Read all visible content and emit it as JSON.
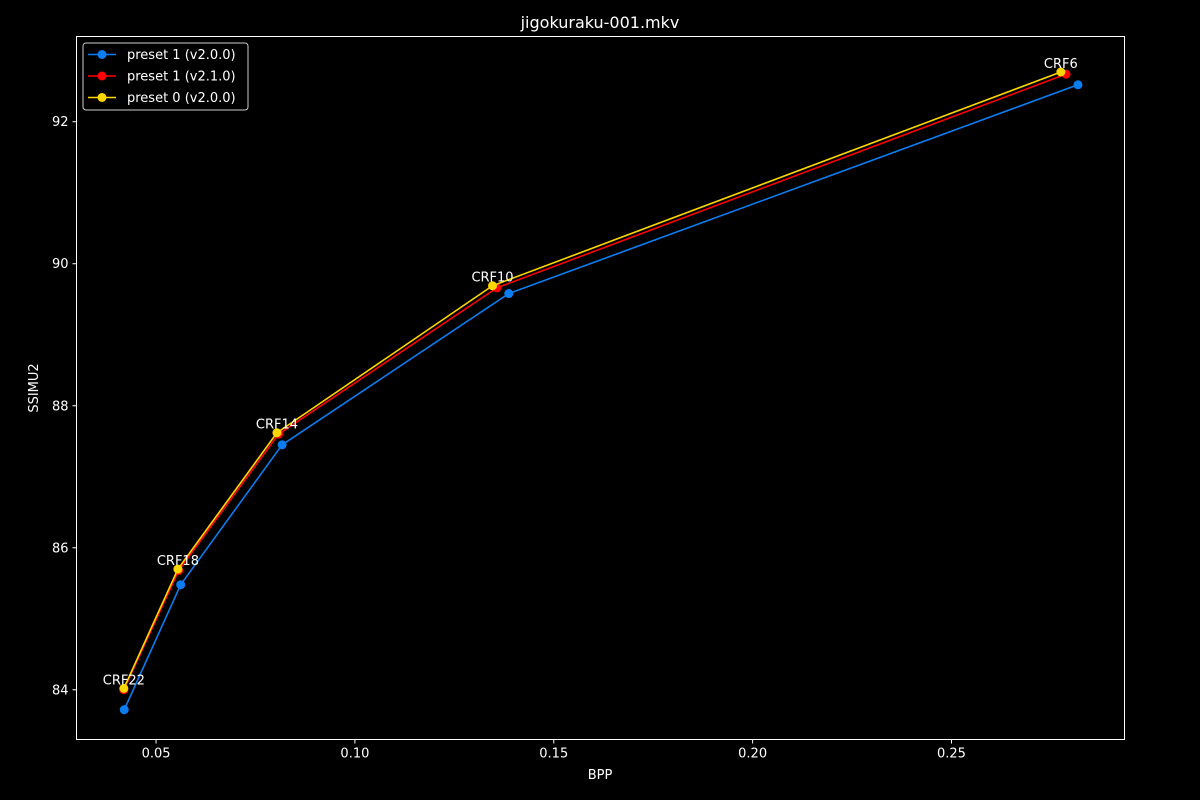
{
  "chart_data": {
    "type": "line",
    "title": "jigokuraku-001.mkv",
    "xlabel": "BPP",
    "ylabel": "SSIMU2",
    "xlim": [
      0.03,
      0.2935
    ],
    "ylim": [
      83.3,
      93.2
    ],
    "x_ticks": [
      0.05,
      0.1,
      0.15,
      0.2,
      0.25
    ],
    "x_tick_labels": [
      "0.05",
      "0.10",
      "0.15",
      "0.20",
      "0.25"
    ],
    "y_ticks": [
      84,
      86,
      88,
      90,
      92
    ],
    "y_tick_labels": [
      "84",
      "86",
      "88",
      "90",
      "92"
    ],
    "grid": false,
    "legend_position": "upper-left",
    "background": "#000000",
    "foreground": "#ffffff",
    "series": [
      {
        "name": "preset 1 (v2.0.0)",
        "color": "#0a7df0",
        "points": [
          {
            "x": 0.042,
            "y": 83.72
          },
          {
            "x": 0.0562,
            "y": 85.48
          },
          {
            "x": 0.0817,
            "y": 87.45
          },
          {
            "x": 0.1387,
            "y": 89.58
          },
          {
            "x": 0.2818,
            "y": 92.52
          }
        ]
      },
      {
        "name": "preset 1 (v2.1.0)",
        "color": "#ff0000",
        "points": [
          {
            "x": 0.0419,
            "y": 84.0
          },
          {
            "x": 0.0557,
            "y": 85.68
          },
          {
            "x": 0.0808,
            "y": 87.6
          },
          {
            "x": 0.1357,
            "y": 89.66
          },
          {
            "x": 0.2788,
            "y": 92.67
          }
        ]
      },
      {
        "name": "preset 0 (v2.0.0)",
        "color": "#ffd700",
        "points": [
          {
            "x": 0.0419,
            "y": 84.02
          },
          {
            "x": 0.0555,
            "y": 85.7
          },
          {
            "x": 0.0804,
            "y": 87.62
          },
          {
            "x": 0.1346,
            "y": 89.69
          },
          {
            "x": 0.2775,
            "y": 92.7
          }
        ]
      }
    ],
    "annotations": [
      {
        "text": "CRF22",
        "x": 0.0419,
        "y": 84.02
      },
      {
        "text": "CRF18",
        "x": 0.0555,
        "y": 85.7
      },
      {
        "text": "CRF14",
        "x": 0.0804,
        "y": 87.62
      },
      {
        "text": "CRF10",
        "x": 0.1346,
        "y": 89.69
      },
      {
        "text": "CRF6",
        "x": 0.2775,
        "y": 92.7
      }
    ]
  }
}
